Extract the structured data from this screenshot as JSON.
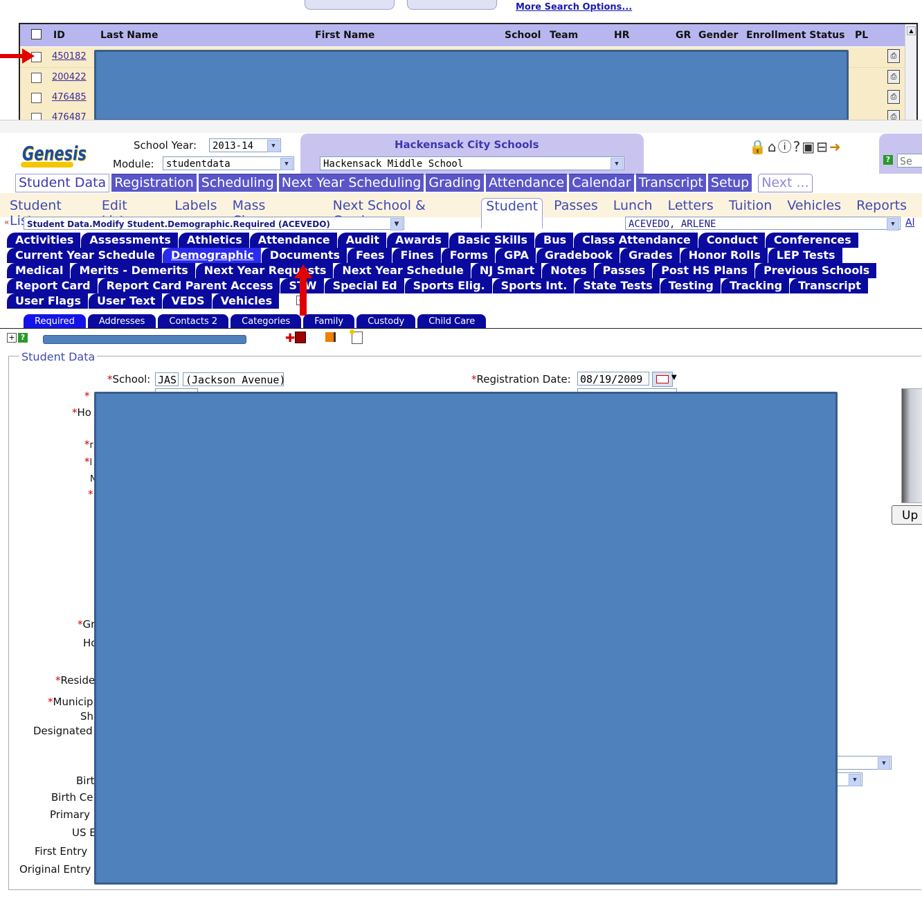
{
  "search": {
    "more_options": "More Search Options..."
  },
  "results": {
    "headers": {
      "id": "ID",
      "last_name": "Last Name",
      "first_name": "First Name",
      "school": "School",
      "team": "Team",
      "hr": "HR",
      "gr": "GR",
      "gender": "Gender",
      "enrollment_status": "Enrollment Status",
      "pl": "PL"
    },
    "rows": [
      {
        "id": "450182"
      },
      {
        "id": "200422"
      },
      {
        "id": "476485"
      },
      {
        "id": "476487"
      }
    ]
  },
  "header": {
    "logo": "Genesis",
    "school_year_label": "School Year:",
    "school_year_value": "2013-14",
    "module_label": "Module:",
    "module_value": "studentdata",
    "district": "Hackensack City Schools",
    "school": "Hackensack Middle School",
    "search_placeholder": "Se"
  },
  "main_nav": [
    "Student Data",
    "Registration",
    "Scheduling",
    "Next Year Scheduling",
    "Grading",
    "Attendance",
    "Calendar",
    "Transcript",
    "Setup",
    "Next ..."
  ],
  "sub_nav": [
    "Student List",
    "Edit Lists",
    "Labels",
    "Mass Change",
    "Next School & Grade",
    "Student",
    "Passes",
    "Lunch",
    "Letters",
    "Tuition",
    "Vehicles",
    "Reports"
  ],
  "breadcrumb": "Student Data.Modify Student.Demographic.Required (ACEVEDO)",
  "student_select": "ACEVEDO, ARLENE",
  "student_link": "Al",
  "blue_tabs": [
    [
      "Activities",
      "Assessments",
      "Athletics",
      "Attendance",
      "Audit",
      "Awards",
      "Basic Skills",
      "Bus",
      "Class Attendance",
      "Conduct",
      "Conferences"
    ],
    [
      "Current Year Schedule",
      "Demographic",
      "Documents",
      "Fees",
      "Fines",
      "Forms",
      "GPA",
      "Gradebook",
      "Grades",
      "Honor Rolls",
      "LEP Tests"
    ],
    [
      "Medical",
      "Merits - Demerits",
      "Next Year Requests",
      "Next Year Schedule",
      "NJ Smart",
      "Notes",
      "Passes",
      "Post HS Plans",
      "Previous Schools"
    ],
    [
      "Report Card",
      "Report Card Parent Access",
      "STW",
      "Special Ed",
      "Sports Elig.",
      "Sports Int.",
      "State Tests",
      "Testing",
      "Tracking",
      "Transcript"
    ],
    [
      "User Flags",
      "User Text",
      "VEDS",
      "Vehicles"
    ]
  ],
  "small_tabs": [
    "Required",
    "Addresses",
    "Contacts 2",
    "Categories",
    "Family",
    "Custody",
    "Child Care"
  ],
  "form": {
    "legend": "Student Data",
    "school_label": "School:",
    "school_code": "JAS",
    "school_name": "(Jackson Avenue)",
    "reg_date_label": "Registration Date:",
    "reg_date_value": "08/19/2009",
    "left_labels": [
      {
        "text": "Ho",
        "required": true
      },
      {
        "text": "Gr",
        "required": true
      },
      {
        "text": "Ho",
        "required": false
      },
      {
        "text": "Reside",
        "required": true
      },
      {
        "text": "Municip",
        "required": true
      },
      {
        "text": "Sh",
        "required": false
      },
      {
        "text": "Designated",
        "required": false
      },
      {
        "text": "Birt",
        "required": false
      },
      {
        "text": "Birth Ce",
        "required": false
      },
      {
        "text": "Primary",
        "required": false
      },
      {
        "text": "US E",
        "required": false
      },
      {
        "text": "First Entry",
        "required": false
      },
      {
        "text": "Original Entry",
        "required": false
      }
    ],
    "upload_label": "Up"
  },
  "colors": {
    "tab_blue": "#0a0a9e",
    "redaction": "#4f81bd",
    "arrow": "#e00000"
  }
}
